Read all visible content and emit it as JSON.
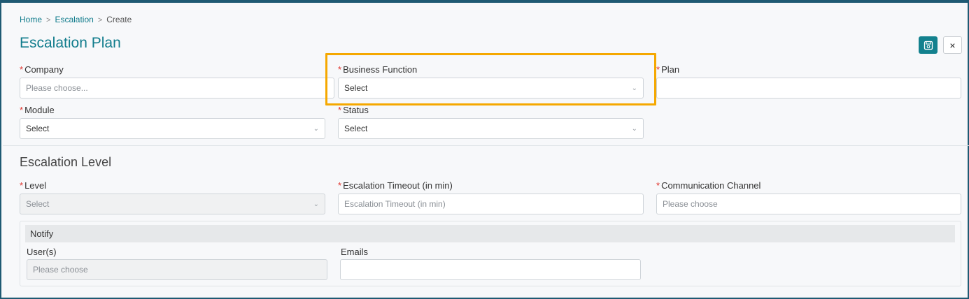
{
  "breadcrumb": {
    "home": "Home",
    "escalation": "Escalation",
    "current": "Create"
  },
  "page": {
    "title": "Escalation Plan"
  },
  "header_actions": {
    "close_label": "×"
  },
  "plan_form": {
    "company": {
      "label": "Company",
      "placeholder": "Please choose..."
    },
    "business_function": {
      "label": "Business Function",
      "value": "Select"
    },
    "plan": {
      "label": "Plan",
      "value": ""
    },
    "module": {
      "label": "Module",
      "value": "Select"
    },
    "status": {
      "label": "Status",
      "value": "Select"
    }
  },
  "escalation_level": {
    "title": "Escalation Level",
    "level": {
      "label": "Level",
      "value": "Select"
    },
    "timeout": {
      "label": "Escalation Timeout (in min)",
      "placeholder": "Escalation Timeout (in min)"
    },
    "channel": {
      "label": "Communication Channel",
      "placeholder": "Please choose"
    }
  },
  "notify": {
    "title": "Notify",
    "users": {
      "label": "User(s)",
      "placeholder": "Please choose"
    },
    "emails": {
      "label": "Emails",
      "value": ""
    }
  },
  "required_marker": "*",
  "colors": {
    "accent": "#117c8c",
    "highlight": "#f5a800",
    "required": "#e0322b",
    "frame": "#1f5a73"
  }
}
